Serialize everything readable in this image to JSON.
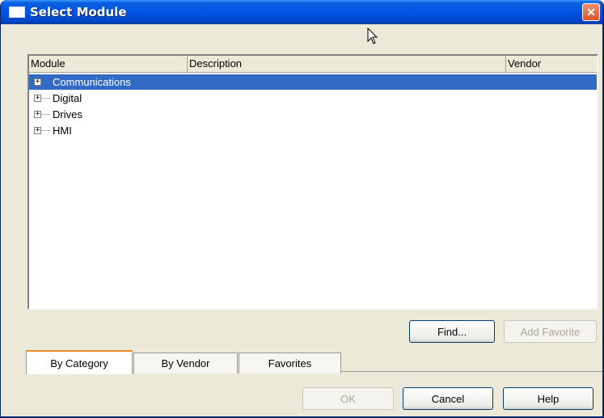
{
  "window": {
    "title": "Select Module",
    "close_glyph": "✕"
  },
  "listview": {
    "columns": [
      "Module",
      "Description",
      "Vendor"
    ],
    "items": [
      {
        "label": "Communications",
        "selected": true
      },
      {
        "label": "Digital",
        "selected": false
      },
      {
        "label": "Drives",
        "selected": false
      },
      {
        "label": "HMI",
        "selected": false
      }
    ],
    "expander_glyph": "+"
  },
  "buttons": {
    "find": "Find...",
    "add_favorite": "Add Favorite",
    "ok": "OK",
    "cancel": "Cancel",
    "help": "Help"
  },
  "tabs": [
    "By Category",
    "By Vendor",
    "Favorites"
  ],
  "colors": {
    "selection": "#316ac5",
    "titlebar": "#0055e5",
    "dialog_bg": "#ece9d8"
  }
}
